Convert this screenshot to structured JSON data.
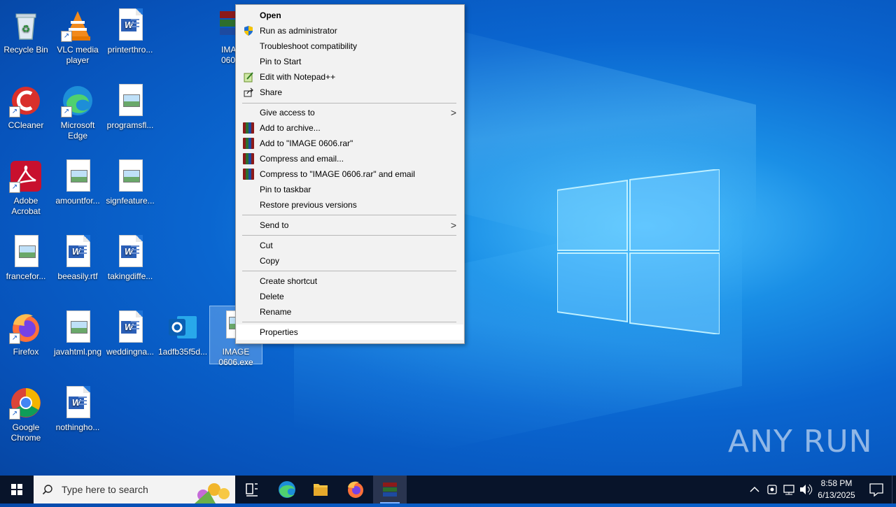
{
  "desktop": {
    "icons": [
      {
        "label": "Recycle Bin"
      },
      {
        "label": "VLC media player"
      },
      {
        "label": "printerthro..."
      },
      {
        "label": "IMA 060"
      },
      {
        "label": "CCleaner"
      },
      {
        "label": "Microsoft Edge"
      },
      {
        "label": "programsfl..."
      },
      {
        "label": "Adobe Acrobat"
      },
      {
        "label": "amountfor..."
      },
      {
        "label": "signfeature..."
      },
      {
        "label": "francefor..."
      },
      {
        "label": "beeasily.rtf"
      },
      {
        "label": "takingdiffe..."
      },
      {
        "label": "Firefox"
      },
      {
        "label": "javahtml.png"
      },
      {
        "label": "weddingna..."
      },
      {
        "label": "1adfb35f5d..."
      },
      {
        "label": "IMAGE 0606.exe"
      },
      {
        "label": "Google Chrome"
      },
      {
        "label": "nothingho..."
      }
    ]
  },
  "context_menu": {
    "items": [
      {
        "label": "Open"
      },
      {
        "label": "Run as administrator"
      },
      {
        "label": "Troubleshoot compatibility"
      },
      {
        "label": "Pin to Start"
      },
      {
        "label": "Edit with Notepad++"
      },
      {
        "label": "Share"
      },
      {
        "label": "Give access to"
      },
      {
        "label": "Add to archive..."
      },
      {
        "label": "Add to \"IMAGE 0606.rar\""
      },
      {
        "label": "Compress and email..."
      },
      {
        "label": "Compress to \"IMAGE 0606.rar\" and email"
      },
      {
        "label": "Pin to taskbar"
      },
      {
        "label": "Restore previous versions"
      },
      {
        "label": "Send to"
      },
      {
        "label": "Cut"
      },
      {
        "label": "Copy"
      },
      {
        "label": "Create shortcut"
      },
      {
        "label": "Delete"
      },
      {
        "label": "Rename"
      },
      {
        "label": "Properties"
      }
    ]
  },
  "taskbar": {
    "search_placeholder": "Type here to search",
    "time": "8:58 PM",
    "date": "6/13/2025"
  },
  "watermark": "ANY RUN",
  "colors": {
    "desktop": "#0a66d0",
    "taskbar": "#08142a",
    "menu": "#f2f2f2"
  }
}
